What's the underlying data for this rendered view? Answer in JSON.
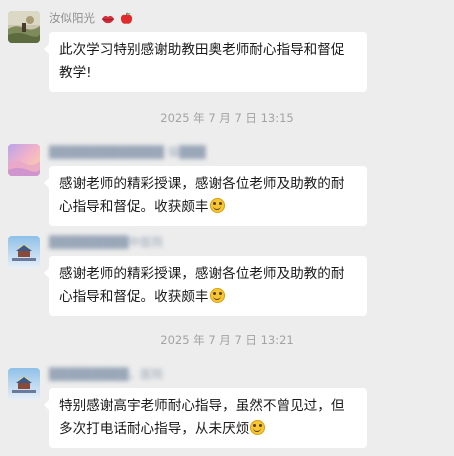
{
  "messages": [
    {
      "sender": "汝似阳光",
      "sender_emoji": [
        "lips-icon",
        "apple-icon"
      ],
      "avatar": "landscape-photo",
      "text": "此次学习特别感谢助教田奥老师耐心指导和督促教学!"
    },
    {
      "timestamp": "2025 年 7 月 7 日 13:15"
    },
    {
      "sender": "█████████████ 保███",
      "sender_blurred": true,
      "avatar": "pastel-sky",
      "text": "感谢老师的精彩授课，感谢各位老师及助教的耐心指导和督促。收获颇丰",
      "emoji": "smile-emoji"
    },
    {
      "sender": "█████████中医院",
      "sender_blurred": true,
      "avatar": "pavilion-sky",
      "text": "感谢老师的精彩授课，感谢各位老师及助教的耐心指导和督促。收获颇丰",
      "emoji": "smile-emoji"
    },
    {
      "timestamp": "2025 年 7 月 7 日 13:21"
    },
    {
      "sender": "█████████，医院",
      "sender_blurred": true,
      "avatar": "pavilion-sky",
      "text": "特别感谢高宇老师耐心指导，虽然不曾见过，但多次打电话耐心指导，从未厌烦",
      "emoji": "smile-emoji"
    }
  ],
  "colors": {
    "background": "#ededed",
    "bubble": "#ffffff",
    "sender_text": "#8e8e8e",
    "timestamp_text": "#a3a3a3"
  }
}
